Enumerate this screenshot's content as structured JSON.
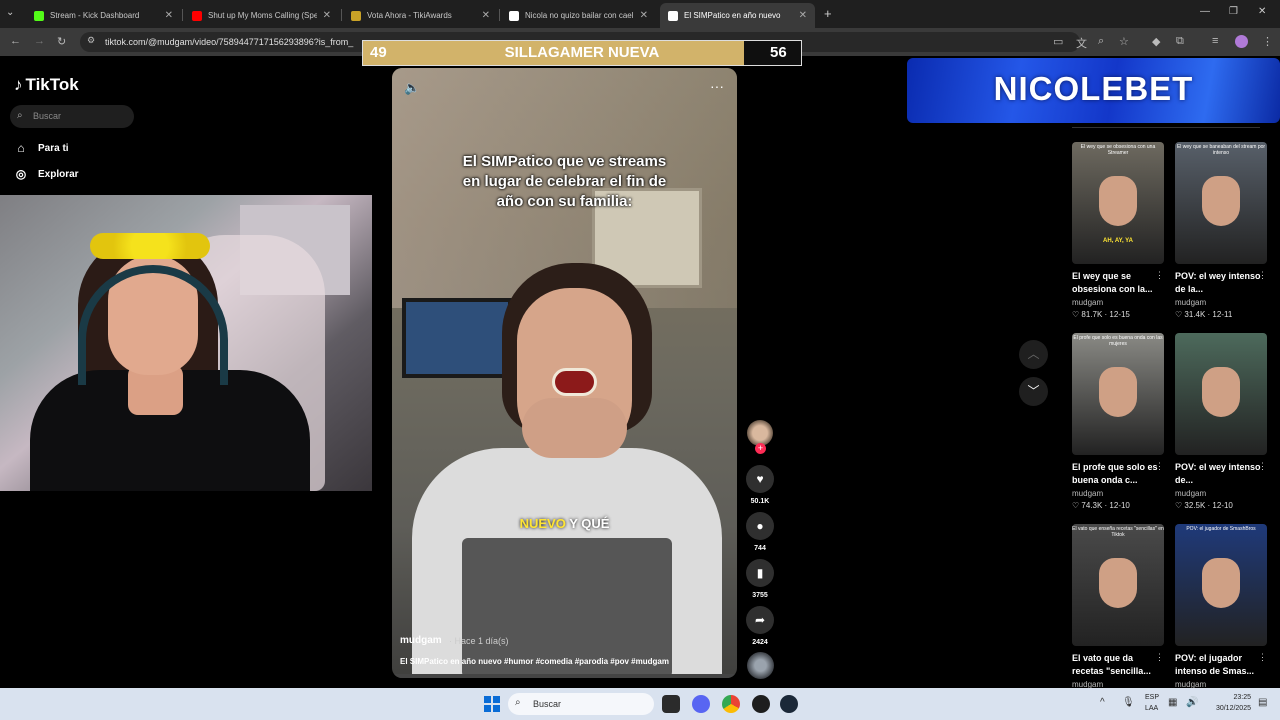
{
  "browser": {
    "tabs": [
      {
        "label": "Stream - Kick Dashboard",
        "favicon_color": "#53fc18",
        "active": false
      },
      {
        "label": "Shut up My Moms Calling (Spe",
        "favicon_color": "#ff0000",
        "active": false
      },
      {
        "label": "Vota Ahora - TikiAwards",
        "favicon_color": "#c9a227",
        "active": false
      },
      {
        "label": "Nicola no quizo bailar con cael",
        "favicon_color": "#ffffff",
        "active": false
      },
      {
        "label": "El SIMPatico en año nuevo",
        "favicon_color": "#ffffff",
        "active": true
      }
    ],
    "url": "tiktok.com/@mudgam/video/7589447717156293896?is_from_"
  },
  "tiktok": {
    "logo": "TikTok",
    "search_placeholder": "Buscar",
    "nav": [
      {
        "label": "Para ti",
        "icon": "home-icon"
      },
      {
        "label": "Explorar",
        "icon": "compass-icon"
      }
    ]
  },
  "overlay_bar": {
    "left_value": "49",
    "title": "SILLAGAMER NUEVA",
    "right_value": "56",
    "fill_fraction": 0.47,
    "fill_color": "#d2b36a"
  },
  "video": {
    "caption": "El SIMPatico que ve streams en lugar de celebrar el fin de año con su familia:",
    "subtitle_highlight": "NUEVO",
    "subtitle_rest": " Y QUÉ",
    "author": "mudgam",
    "time": "· Hace 1 día(s)",
    "description": "El SIMPatico en año nuevo #humor #comedia #parodia #pov #mudgam",
    "progress_fraction": 0.0
  },
  "actions": {
    "likes": "50.1K",
    "comments": "744",
    "saves": "3755",
    "shares": "2424"
  },
  "banner": {
    "text": "NICOLEBET"
  },
  "related": [
    {
      "title": "El wey que se obsesiona con la...",
      "author": "mudgam",
      "views": "81.7K",
      "date": "12-15",
      "overlay": "El wey que se obsesiona con una Streamer",
      "tag": "AH, AY, YA",
      "bg": "#6e6a60"
    },
    {
      "title": "POV: el wey intenso de la...",
      "author": "mudgam",
      "views": "31.4K",
      "date": "12-11",
      "overlay": "El wey que se baneaban del stream por intenso",
      "tag": "",
      "bg": "#58606a"
    },
    {
      "title": "El profe que solo es buena onda c...",
      "author": "mudgam",
      "views": "74.3K",
      "date": "12-10",
      "overlay": "El profe que solo es buena onda con las mujeres",
      "tag": "",
      "bg": "#8a8a85"
    },
    {
      "title": "POV: el wey intenso de...",
      "author": "mudgam",
      "views": "32.5K",
      "date": "12-10",
      "overlay": "",
      "tag": "",
      "bg": "#4d6a5c"
    },
    {
      "title": "El vato que da recetas \"sencilla...",
      "author": "mudgam",
      "views": "",
      "date": "",
      "overlay": "El vato que enseña recetas \"sencillas\" en Tiktok",
      "tag": "",
      "bg": "#4a4a4a"
    },
    {
      "title": "POV: el jugador intenso de Smas...",
      "author": "mudgam",
      "views": "",
      "date": "",
      "overlay": "POV: el jugador de SmashBros",
      "tag": "",
      "bg": "#1f3a7a"
    }
  ],
  "taskbar": {
    "search": "Buscar",
    "lang1": "ESP",
    "lang2": "LAA",
    "time": "23:25",
    "date": "30/12/2025"
  }
}
